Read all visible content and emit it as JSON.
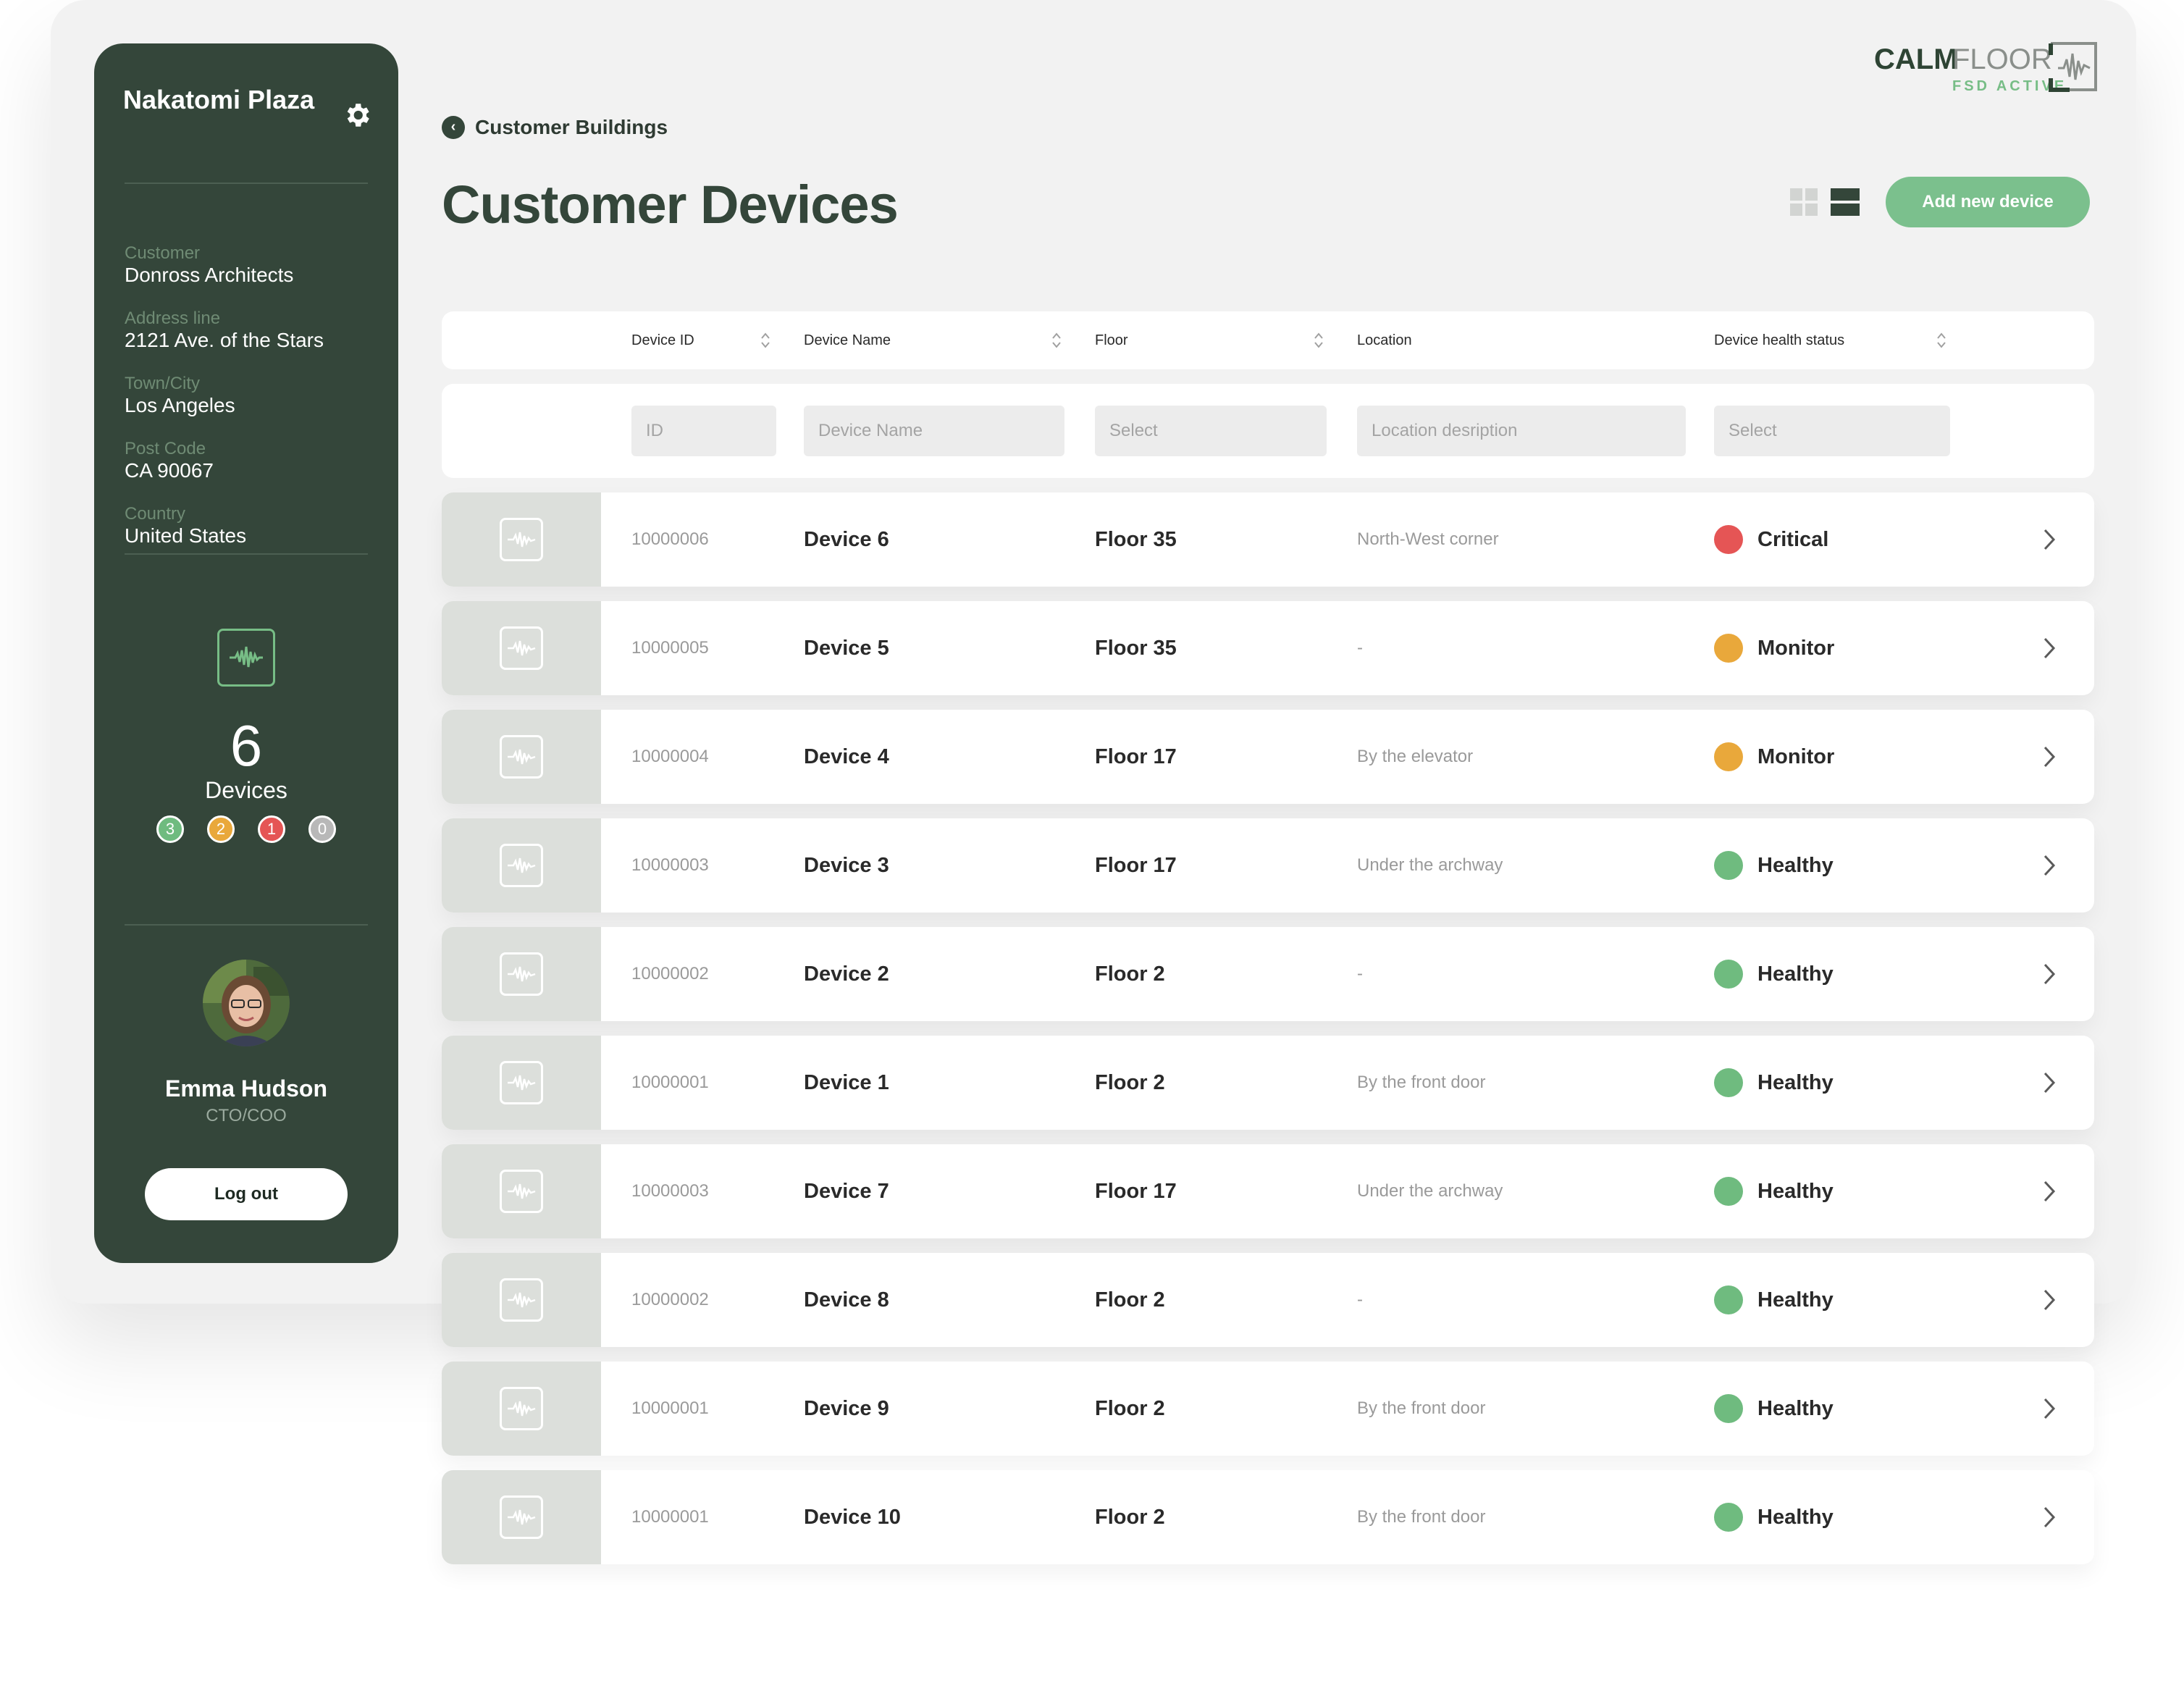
{
  "building": {
    "name": "Nakatomi Plaza"
  },
  "customer_fields": [
    {
      "label": "Customer",
      "value": "Donross Architects"
    },
    {
      "label": "Address line",
      "value": "2121 Ave. of the Stars"
    },
    {
      "label": "Town/City",
      "value": "Los Angeles"
    },
    {
      "label": "Post Code",
      "value": "CA 90067"
    },
    {
      "label": "Country",
      "value": "United States"
    }
  ],
  "device_summary": {
    "count": "6",
    "label": "Devices",
    "status_counts": [
      {
        "value": "3",
        "color": "#6fbb7f"
      },
      {
        "value": "2",
        "color": "#e9a83b"
      },
      {
        "value": "1",
        "color": "#e55555"
      },
      {
        "value": "0",
        "color": "#b8b8b8"
      }
    ]
  },
  "user": {
    "name": "Emma Hudson",
    "role": "CTO/COO",
    "logout_label": "Log out"
  },
  "logo": {
    "calm": "CALM",
    "floor": "FLOOR",
    "sub": "FSD ACTIVE"
  },
  "breadcrumb": {
    "back_label": "Customer Buildings"
  },
  "page": {
    "title": "Customer Devices",
    "add_button": "Add new device"
  },
  "table": {
    "columns": [
      "Device ID",
      "Device Name",
      "Floor",
      "Location",
      "Device health status"
    ],
    "filters": {
      "id_placeholder": "ID",
      "name_placeholder": "Device Name",
      "floor_placeholder": "Select",
      "location_placeholder": "Location desription",
      "status_placeholder": "Select"
    },
    "rows": [
      {
        "id": "10000006",
        "name": "Device 6",
        "floor": "Floor 35",
        "location": "North-West corner",
        "status": "Critical",
        "status_color": "#e55555"
      },
      {
        "id": "10000005",
        "name": "Device 5",
        "floor": "Floor 35",
        "location": "-",
        "status": "Monitor",
        "status_color": "#e9a83b"
      },
      {
        "id": "10000004",
        "name": "Device 4",
        "floor": "Floor 17",
        "location": "By the elevator",
        "status": "Monitor",
        "status_color": "#e9a83b"
      },
      {
        "id": "10000003",
        "name": "Device 3",
        "floor": "Floor 17",
        "location": "Under the archway",
        "status": "Healthy",
        "status_color": "#6fbb7f"
      },
      {
        "id": "10000002",
        "name": "Device 2",
        "floor": "Floor 2",
        "location": "-",
        "status": "Healthy",
        "status_color": "#6fbb7f"
      },
      {
        "id": "10000001",
        "name": "Device 1",
        "floor": "Floor 2",
        "location": "By the front door",
        "status": "Healthy",
        "status_color": "#6fbb7f"
      },
      {
        "id": "10000003",
        "name": "Device 7",
        "floor": "Floor 17",
        "location": "Under the archway",
        "status": "Healthy",
        "status_color": "#6fbb7f"
      },
      {
        "id": "10000002",
        "name": "Device 8",
        "floor": "Floor 2",
        "location": "-",
        "status": "Healthy",
        "status_color": "#6fbb7f"
      },
      {
        "id": "10000001",
        "name": "Device 9",
        "floor": "Floor 2",
        "location": "By the front door",
        "status": "Healthy",
        "status_color": "#6fbb7f"
      },
      {
        "id": "10000001",
        "name": "Device 10",
        "floor": "Floor 2",
        "location": "By the front door",
        "status": "Healthy",
        "status_color": "#6fbb7f"
      }
    ]
  },
  "icons": {
    "settings": "gear-icon",
    "back": "chevron-left-icon",
    "grid_view": "grid-view-icon",
    "list_view": "list-view-icon",
    "device": "waveform-icon",
    "sort": "sort-icon",
    "row_action": "chevron-right-icon"
  }
}
